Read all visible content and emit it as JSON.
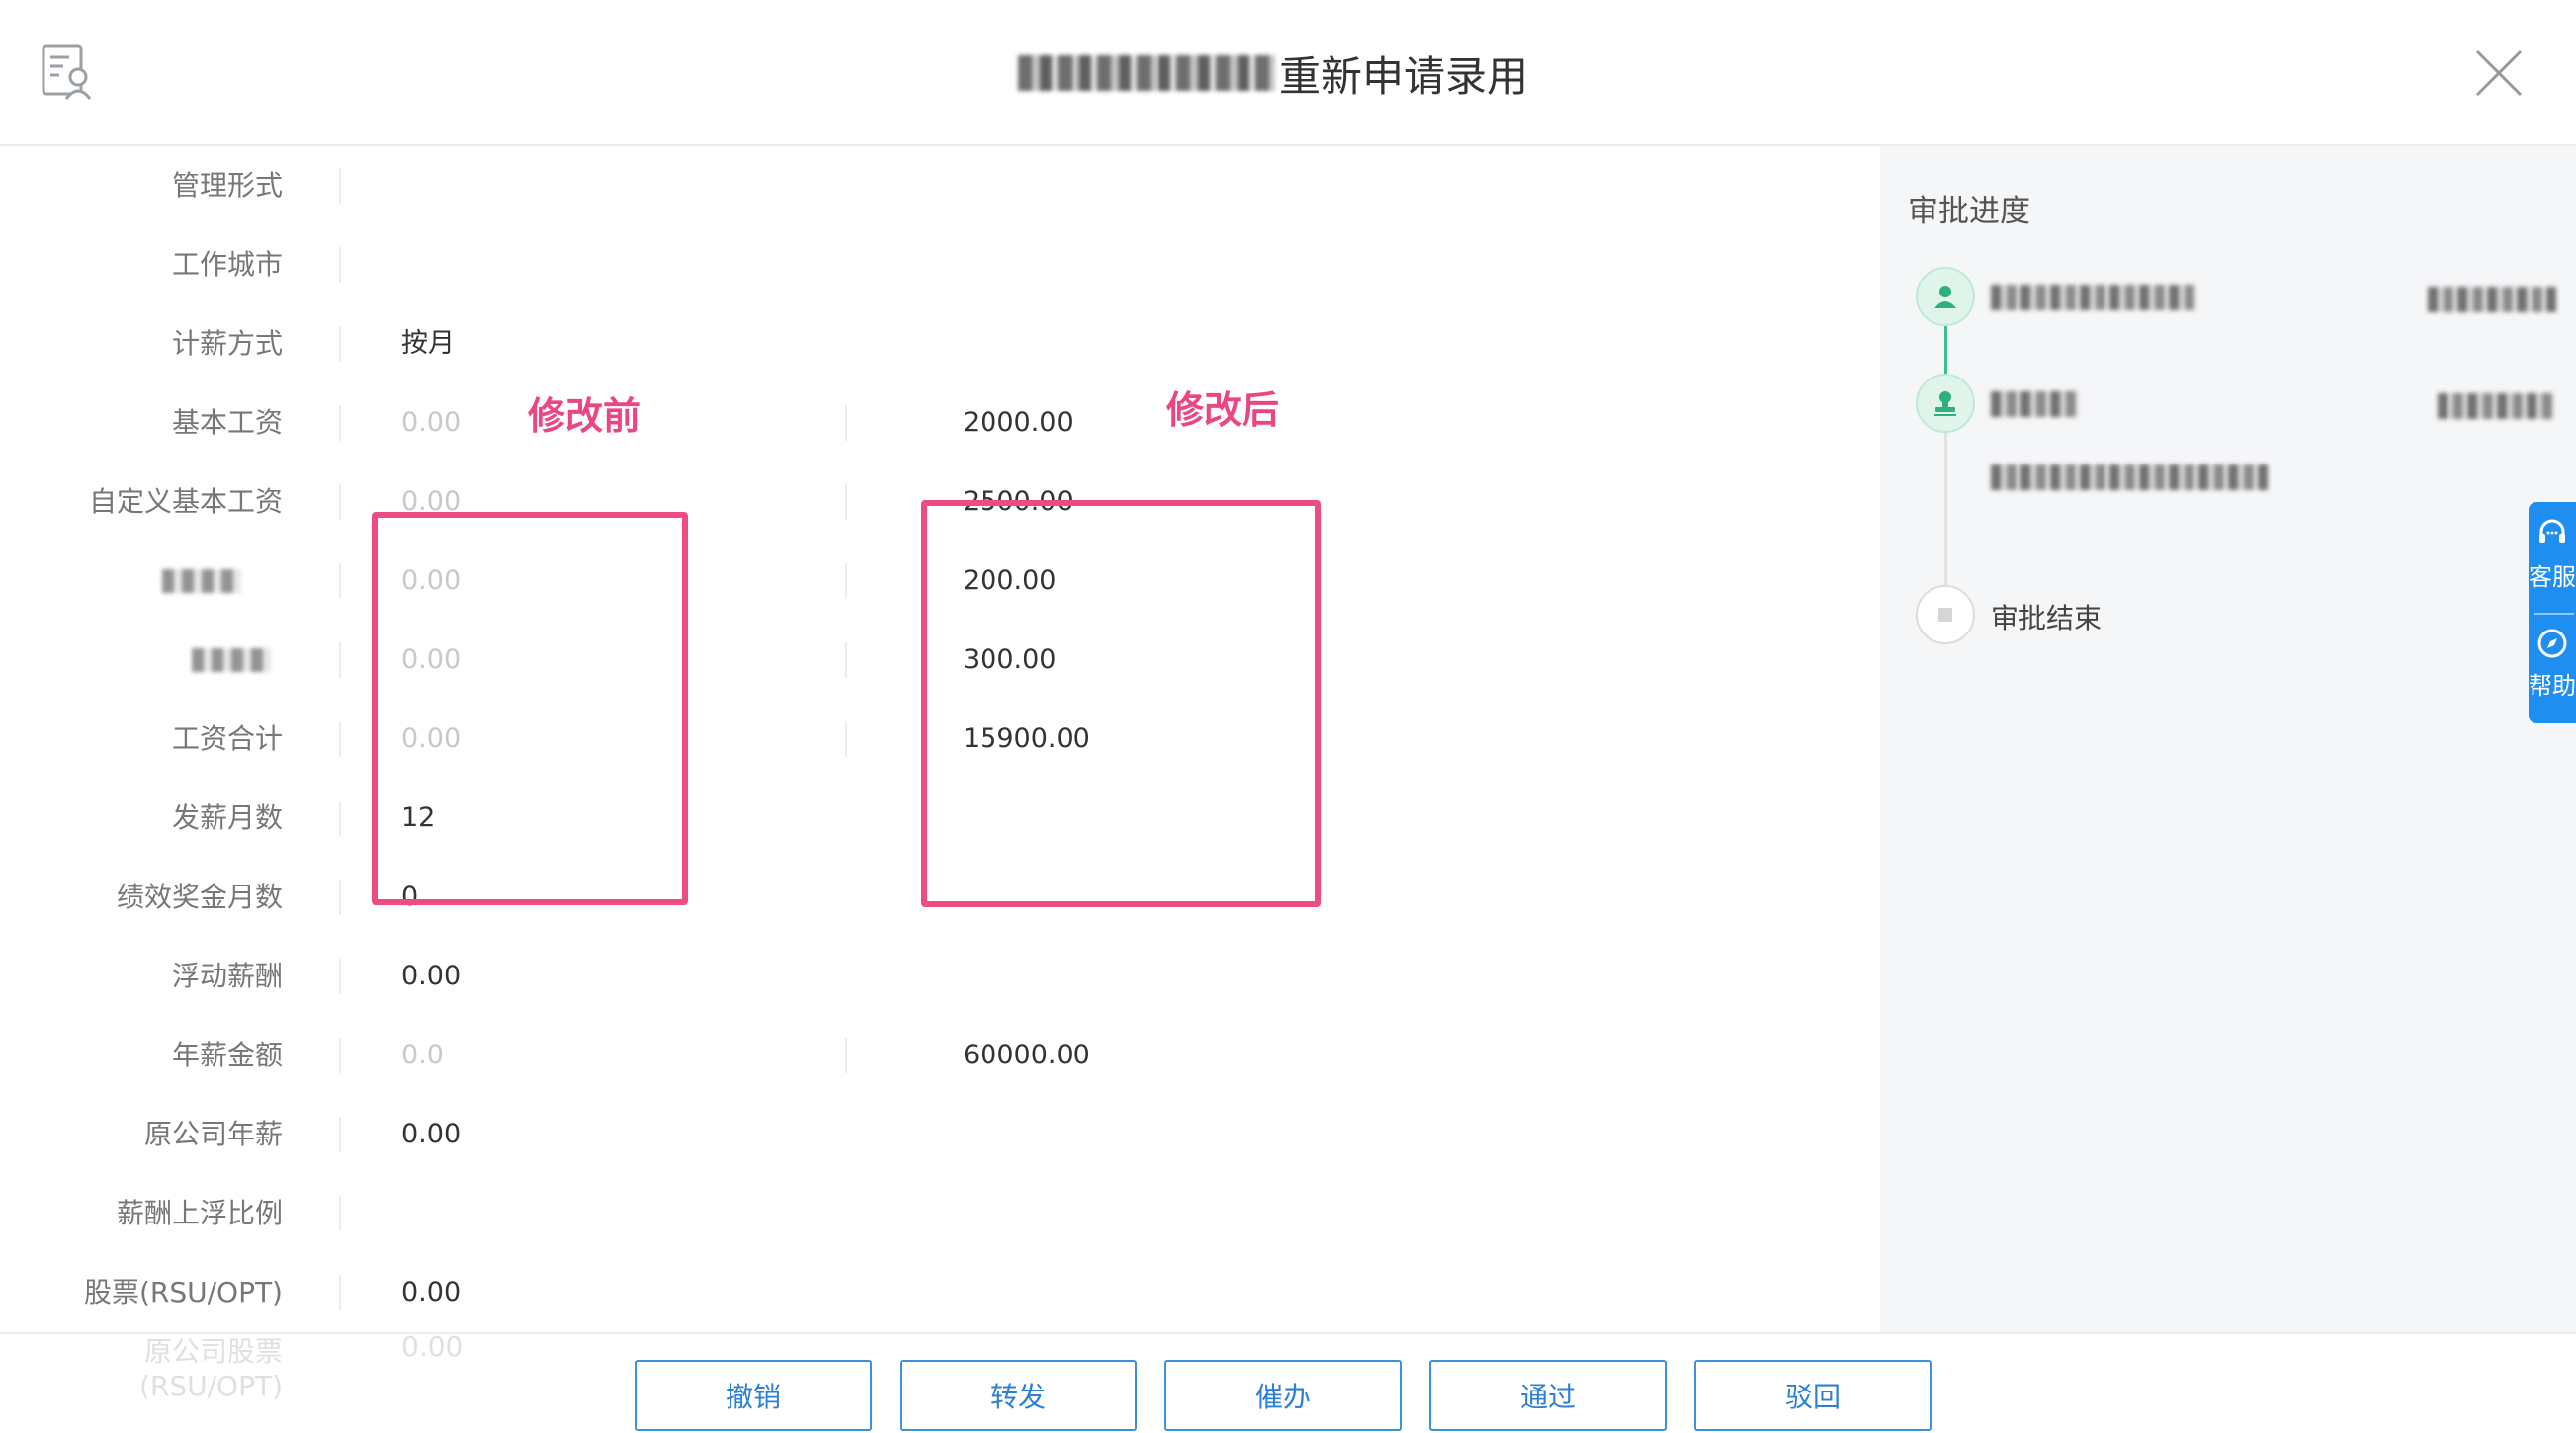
{
  "header": {
    "title": "重新申请录用"
  },
  "form": {
    "rows": [
      {
        "label": "管理形式",
        "value": "",
        "after": ""
      },
      {
        "label": "工作城市",
        "value": "",
        "after": ""
      },
      {
        "label": "计薪方式",
        "value": "按月",
        "after": ""
      },
      {
        "label": "基本工资",
        "value": "0.00",
        "after": "2000.00"
      },
      {
        "label": "自定义基本工资",
        "value": "0.00",
        "after": "2500.00"
      },
      {
        "label": "",
        "value": "0.00",
        "after": "200.00"
      },
      {
        "label": "",
        "value": "0.00",
        "after": "300.00"
      },
      {
        "label": "工资合计",
        "value": "0.00",
        "after": "15900.00"
      },
      {
        "label": "发薪月数",
        "value": "12",
        "after": ""
      },
      {
        "label": "绩效奖金月数",
        "value": "0",
        "after": ""
      },
      {
        "label": "浮动薪酬",
        "value": "0.00",
        "after": ""
      },
      {
        "label": "年薪金额",
        "value": "0.0",
        "after": "60000.00"
      },
      {
        "label": "原公司年薪",
        "value": "0.00",
        "after": ""
      },
      {
        "label": "薪酬上浮比例",
        "value": "",
        "after": ""
      },
      {
        "label": "股票(RSU/OPT)",
        "value": "0.00",
        "after": ""
      }
    ],
    "annotations": {
      "before": "修改前",
      "after": "修改后"
    },
    "faded_row": {
      "label_line1": "原公司股票",
      "label_line2": "(RSU/OPT)",
      "value": "0.00"
    }
  },
  "panel": {
    "title": "审批进度",
    "end_label": "审批结束"
  },
  "float": {
    "service": "客服",
    "help": "帮助"
  },
  "footer": {
    "buttons": {
      "revoke": "撤销",
      "forward": "转发",
      "urge": "催办",
      "approve": "通过",
      "reject": "驳回"
    }
  }
}
